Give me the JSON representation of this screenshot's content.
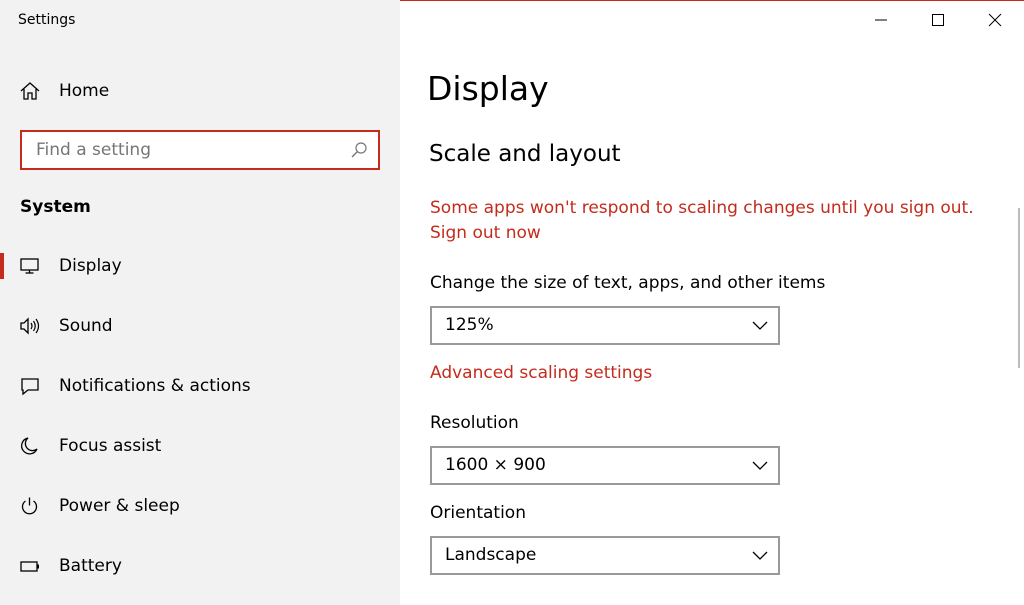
{
  "window": {
    "title": "Settings",
    "accent_color": "#c42b1c"
  },
  "sidebar": {
    "home": {
      "label": "Home",
      "icon": "home-icon"
    },
    "search": {
      "placeholder": "Find a setting",
      "icon": "search-icon"
    },
    "section_heading": "System",
    "items": [
      {
        "label": "Display",
        "icon": "monitor-icon",
        "selected": true
      },
      {
        "label": "Sound",
        "icon": "speaker-icon",
        "selected": false
      },
      {
        "label": "Notifications & actions",
        "icon": "notification-icon",
        "selected": false
      },
      {
        "label": "Focus assist",
        "icon": "moon-icon",
        "selected": false
      },
      {
        "label": "Power & sleep",
        "icon": "power-icon",
        "selected": false
      },
      {
        "label": "Battery",
        "icon": "battery-icon",
        "selected": false
      }
    ]
  },
  "content": {
    "title": "Display",
    "scale_section": {
      "heading": "Scale and layout",
      "warning": "Some apps won't respond to scaling changes until you sign out.",
      "sign_out_link": "Sign out now",
      "size_label": "Change the size of text, apps, and other items",
      "size_value": "125%",
      "advanced_link": "Advanced scaling settings",
      "resolution_label": "Resolution",
      "resolution_value": "1600 × 900",
      "orientation_label": "Orientation",
      "orientation_value": "Landscape"
    }
  }
}
